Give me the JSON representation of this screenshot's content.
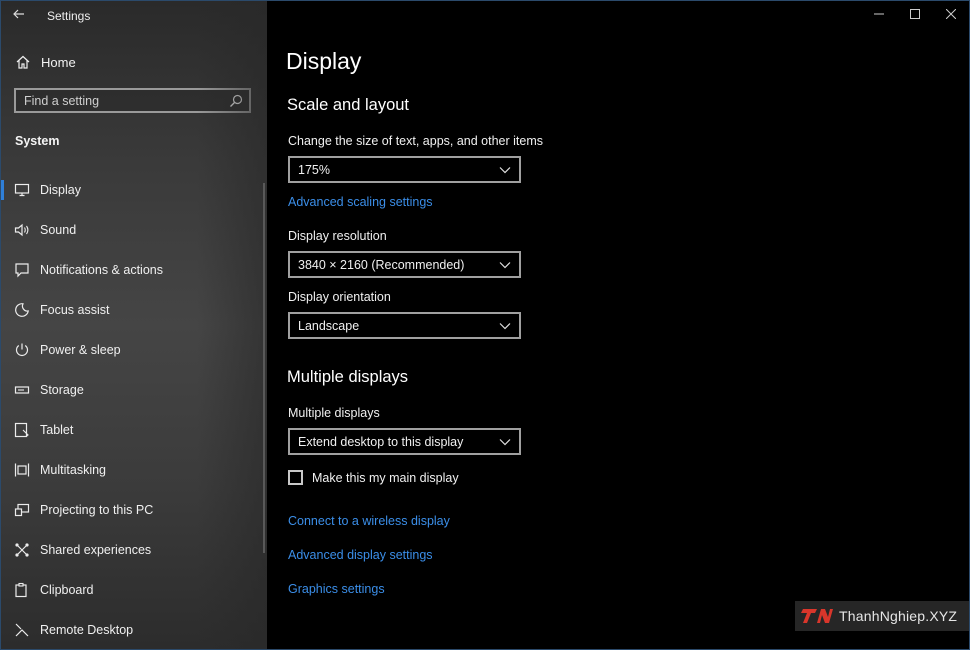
{
  "window": {
    "title": "Settings"
  },
  "sidebar": {
    "home_label": "Home",
    "search_placeholder": "Find a setting",
    "section_label": "System",
    "items": [
      {
        "label": "Display",
        "icon": "monitor-icon",
        "active": true
      },
      {
        "label": "Sound",
        "icon": "speaker-icon"
      },
      {
        "label": "Notifications & actions",
        "icon": "notification-icon"
      },
      {
        "label": "Focus assist",
        "icon": "moon-icon"
      },
      {
        "label": "Power & sleep",
        "icon": "power-icon"
      },
      {
        "label": "Storage",
        "icon": "storage-icon"
      },
      {
        "label": "Tablet",
        "icon": "tablet-icon"
      },
      {
        "label": "Multitasking",
        "icon": "multitasking-icon"
      },
      {
        "label": "Projecting to this PC",
        "icon": "projecting-icon"
      },
      {
        "label": "Shared experiences",
        "icon": "shared-icon"
      },
      {
        "label": "Clipboard",
        "icon": "clipboard-icon"
      },
      {
        "label": "Remote Desktop",
        "icon": "remote-desktop-icon"
      }
    ]
  },
  "main": {
    "page_title": "Display",
    "scale_layout": {
      "heading": "Scale and layout",
      "scale_label": "Change the size of text, apps, and other items",
      "scale_value": "175%",
      "advanced_scaling_link": "Advanced scaling settings",
      "resolution_label": "Display resolution",
      "resolution_value": "3840 × 2160 (Recommended)",
      "orientation_label": "Display orientation",
      "orientation_value": "Landscape"
    },
    "multiple_displays": {
      "heading": "Multiple displays",
      "label": "Multiple displays",
      "value": "Extend desktop to this display",
      "main_display_checkbox": "Make this my main display",
      "main_display_checked": false,
      "wireless_link": "Connect to a wireless display",
      "advanced_display_link": "Advanced display settings",
      "graphics_link": "Graphics settings"
    }
  },
  "watermark": {
    "text": "ThanhNghiep.XYZ"
  },
  "colors": {
    "accent": "#2f7fd8",
    "link": "#3b8ee8",
    "background": "#000000"
  }
}
